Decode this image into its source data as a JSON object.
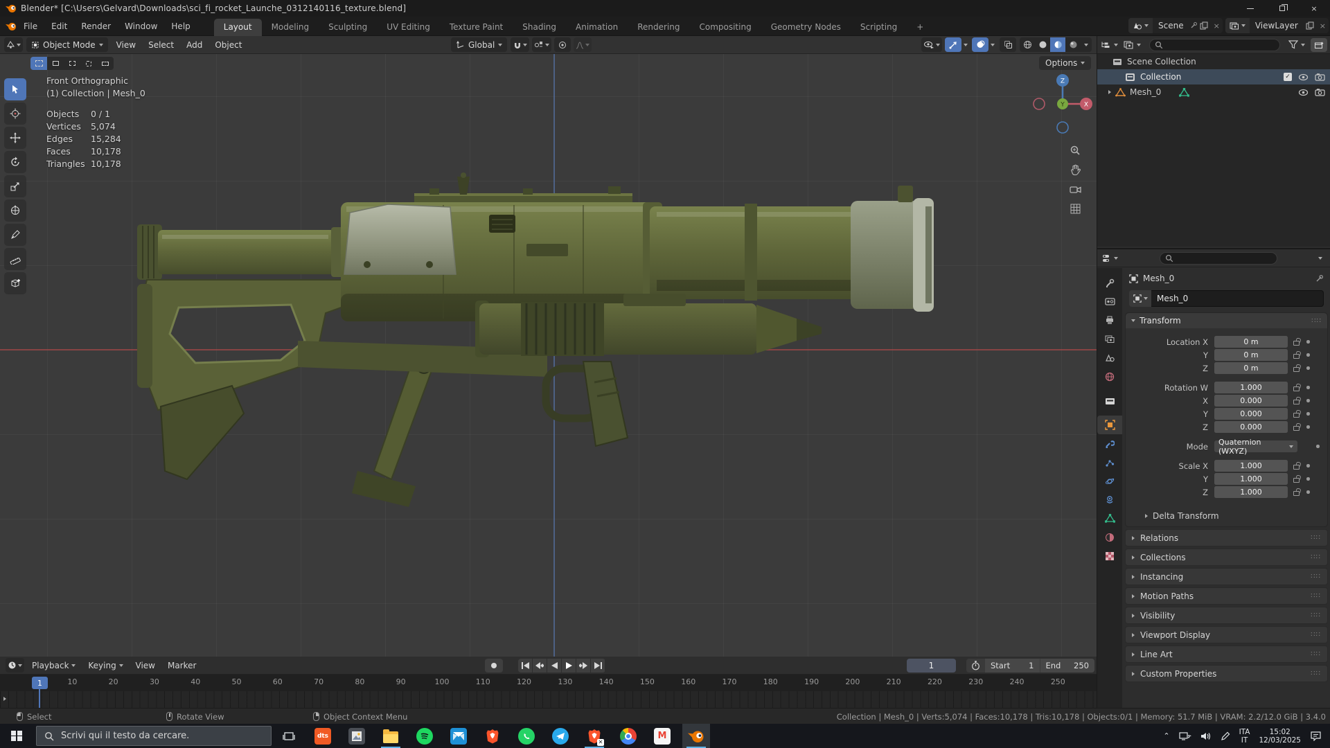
{
  "titlebar": {
    "title": "Blender* [C:\\Users\\Gelvard\\Downloads\\sci_fi_rocket_Launche_0312140116_texture.blend]"
  },
  "menubar": {
    "menus": [
      "File",
      "Edit",
      "Render",
      "Window",
      "Help"
    ],
    "tabs": [
      "Layout",
      "Modeling",
      "Sculpting",
      "UV Editing",
      "Texture Paint",
      "Shading",
      "Animation",
      "Rendering",
      "Compositing",
      "Geometry Nodes",
      "Scripting",
      "+"
    ],
    "active_tab": "Layout",
    "scene_selector": "Scene",
    "viewlayer_selector": "ViewLayer"
  },
  "viewport_header": {
    "mode": "Object Mode",
    "menus": [
      "View",
      "Select",
      "Add",
      "Object"
    ],
    "orientation": "Global",
    "options_label": "Options"
  },
  "viewport_info": {
    "view": "Front Orthographic",
    "context": "(1) Collection | Mesh_0",
    "stats": [
      [
        "Objects",
        "0 / 1"
      ],
      [
        "Vertices",
        "5,074"
      ],
      [
        "Edges",
        "15,284"
      ],
      [
        "Faces",
        "10,178"
      ],
      [
        "Triangles",
        "10,178"
      ]
    ]
  },
  "toolbar_tools": [
    "select-box",
    "cursor",
    "move",
    "rotate",
    "scale",
    "transform",
    "annotate",
    "measure",
    "add-cube"
  ],
  "outliner": {
    "rows": [
      {
        "label": "Scene Collection"
      },
      {
        "label": "Collection"
      },
      {
        "label": "Mesh_0"
      }
    ]
  },
  "properties": {
    "breadcrumb": "Mesh_0",
    "name_field": "Mesh_0",
    "active_tab": "object",
    "transform": {
      "title": "Transform",
      "location_rows": [
        {
          "label": "Location X",
          "value": "0 m"
        },
        {
          "label": "Y",
          "value": "0 m"
        },
        {
          "label": "Z",
          "value": "0 m"
        }
      ],
      "rotation_rows": [
        {
          "label": "Rotation W",
          "value": "1.000"
        },
        {
          "label": "X",
          "value": "0.000"
        },
        {
          "label": "Y",
          "value": "0.000"
        },
        {
          "label": "Z",
          "value": "0.000"
        }
      ],
      "mode": {
        "label": "Mode",
        "value": "Quaternion (WXYZ)"
      },
      "scale_rows": [
        {
          "label": "Scale X",
          "value": "1.000"
        },
        {
          "label": "Y",
          "value": "1.000"
        },
        {
          "label": "Z",
          "value": "1.000"
        }
      ],
      "delta_label": "Delta Transform"
    },
    "panels": [
      "Relations",
      "Collections",
      "Instancing",
      "Motion Paths",
      "Visibility",
      "Viewport Display",
      "Line Art",
      "Custom Properties"
    ]
  },
  "timeline": {
    "menus": [
      "Playback",
      "Keying",
      "View",
      "Marker"
    ],
    "current_frame": "1",
    "first_frame_chip": "1",
    "start_label": "Start",
    "start_value": "1",
    "end_label": "End",
    "end_value": "250",
    "ticks": [
      10,
      20,
      30,
      40,
      50,
      60,
      70,
      80,
      90,
      100,
      110,
      120,
      130,
      140,
      150,
      160,
      170,
      180,
      190,
      200,
      210,
      220,
      230,
      240,
      250
    ]
  },
  "statusbar": {
    "hints": [
      "Select",
      "Rotate View",
      "Object Context Menu"
    ],
    "info": "Collection | Mesh_0 | Verts:5,074 | Faces:10,178 | Tris:10,178 | Objects:0/1 | Memory: 51.7 MiB | VRAM: 2.2/12.0 GiB | 3.4.0"
  },
  "taskbar": {
    "search_placeholder": "Scrivi qui il testo da cercare.",
    "dts_label": "dts",
    "gmail_label": "M",
    "tray": {
      "lang_top": "ITA",
      "lang_bottom": "IT",
      "time": "15:02",
      "date": "12/03/2025"
    }
  },
  "colors": {
    "accent_blue": "#4f76b8",
    "olive": "#5b6238",
    "taskbar_underline": "#5fb2e6"
  }
}
